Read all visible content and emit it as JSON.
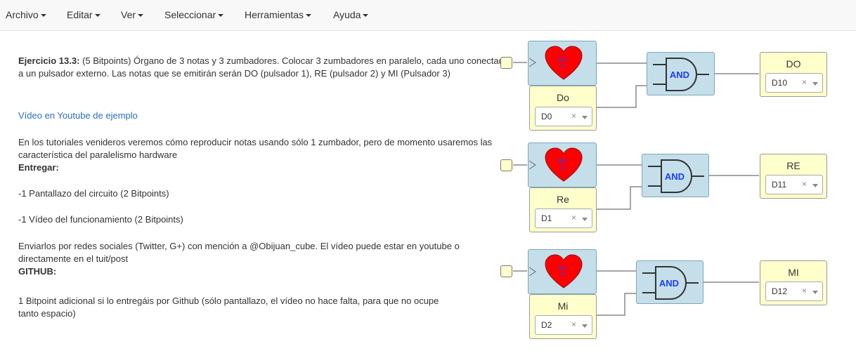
{
  "menu": [
    {
      "label": "Archivo"
    },
    {
      "label": "Editar"
    },
    {
      "label": "Ver"
    },
    {
      "label": "Seleccionar"
    },
    {
      "label": "Herramientas"
    },
    {
      "label": "Ayuda"
    }
  ],
  "info": {
    "exercise_title": "Ejercicio 13.3:",
    "exercise_text": " (5 Bitpoints) Órgano de 3 notas y 3 zumbadores. Colocar 3 zumbadores en paralelo, cada uno conectado a un pulsador externo. Las notas que se emitirán serán DO (pulsador 1), RE (pulsador 2) y MI (Pulsador 3)",
    "video_link": "Vídeo en Youtube de ejemplo",
    "tutorial_text": "En los tutoriales venideros veremos cómo reproducir notas usando sólo 1 zumbador, pero de momento usaremos las característica del paralelismo hardware",
    "deliver_title": "Entregar:",
    "deliver_item1": "-1 Pantallazo del circuito (2 Bitpoints)",
    "deliver_item2": "-1 Vídeo del funcionamiento (2 Bitpoints)",
    "social_text": "Enviarlos por redes sociales (Twitter, G+) con mención a @Obijuan_cube. El vídeo puede estar en youtube o directamente en el tuit/post",
    "github_title": "GITHUB:",
    "github_text": "1 Bitpoint adicional si lo entregáis por Github (sólo pantallazo, el vídeo no hace falta, para que no ocupe tanto espacio)"
  },
  "rows": [
    {
      "note_label": "DO",
      "note_num": "4",
      "input_label": "Do",
      "input_pin": "D0",
      "gate_label": "AND",
      "output_label": "DO",
      "output_pin": "D10"
    },
    {
      "note_label": "RE",
      "note_num": "4",
      "input_label": "Re",
      "input_pin": "D1",
      "gate_label": "AND",
      "output_label": "RE",
      "output_pin": "D11"
    },
    {
      "note_label": "MI",
      "note_num": "4",
      "input_label": "Mi",
      "input_pin": "D2",
      "gate_label": "AND",
      "output_label": "MI",
      "output_pin": "D12"
    }
  ],
  "colors": {
    "heart": "#ff0000",
    "block_blue": "#c4dfea",
    "block_yellow": "#ffffcc",
    "link": "#2a6fc0",
    "gate_text": "#1a3cff"
  },
  "select_clear_symbol": "×"
}
